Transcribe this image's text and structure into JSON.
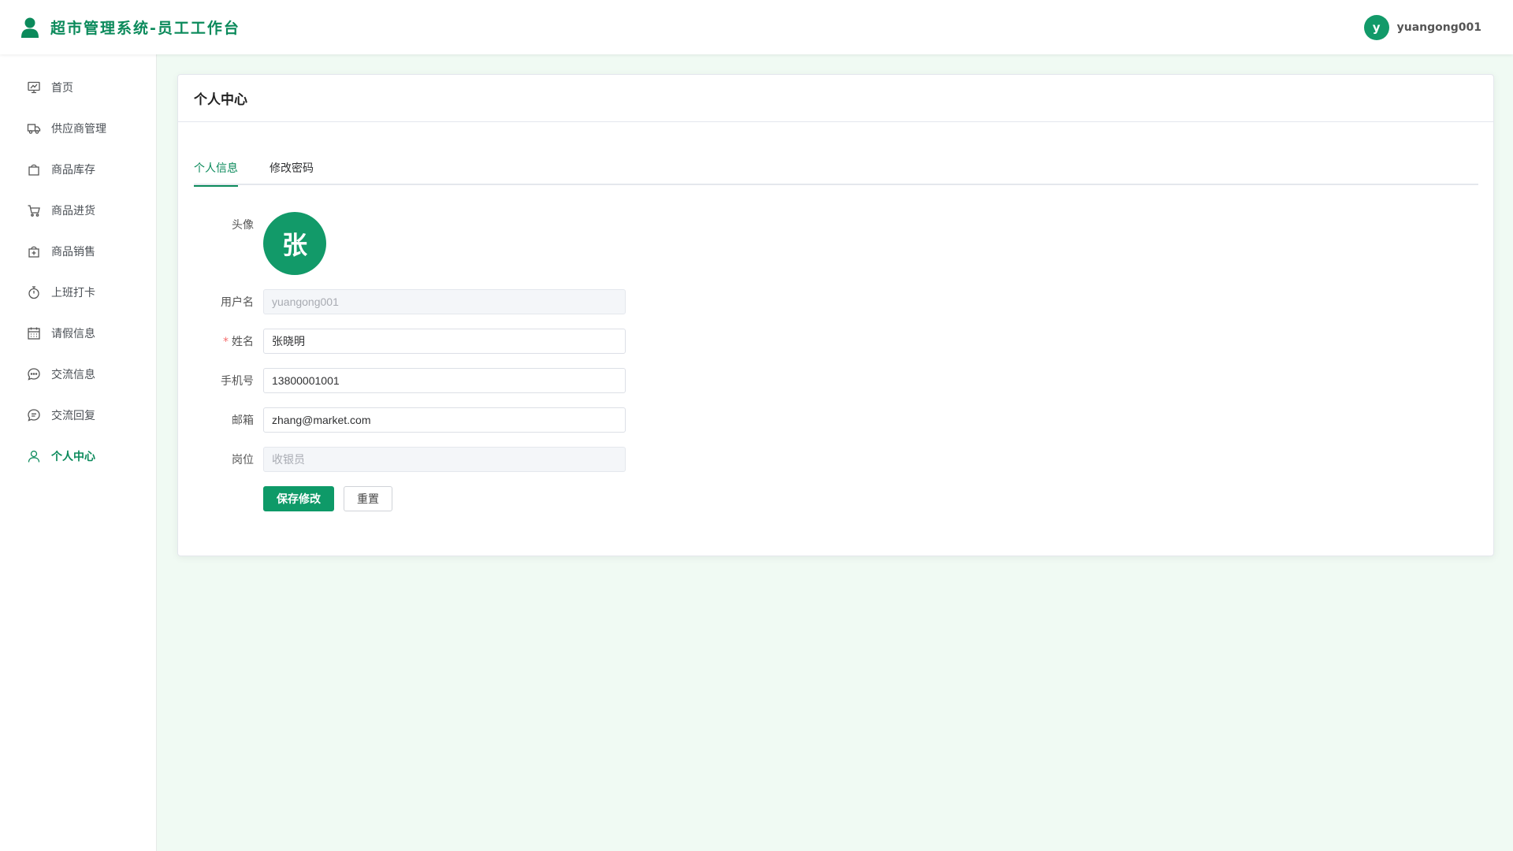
{
  "header": {
    "title": "超市管理系统-员工工作台",
    "user_initial": "y",
    "username": "yuangong001",
    "accent": "#0b8a5b"
  },
  "sidebar": {
    "items": [
      {
        "label": "首页",
        "icon": "dashboard-icon"
      },
      {
        "label": "供应商管理",
        "icon": "truck-icon"
      },
      {
        "label": "商品库存",
        "icon": "shopping-bag-icon"
      },
      {
        "label": "商品进货",
        "icon": "shopping-cart-icon"
      },
      {
        "label": "商品销售",
        "icon": "bag-add-icon"
      },
      {
        "label": "上班打卡",
        "icon": "stopwatch-icon"
      },
      {
        "label": "请假信息",
        "icon": "calendar-icon"
      },
      {
        "label": "交流信息",
        "icon": "chat-dot-icon"
      },
      {
        "label": "交流回复",
        "icon": "chat-line-icon"
      },
      {
        "label": "个人中心",
        "icon": "user-icon",
        "active": true
      }
    ]
  },
  "main": {
    "card_title": "个人中心",
    "tabs": [
      {
        "label": "个人信息",
        "active": true
      },
      {
        "label": "修改密码",
        "active": false
      }
    ],
    "form": {
      "avatar_label": "头像",
      "avatar_char": "张",
      "username_label": "用户名",
      "username_value": "yuangong001",
      "name_label": "姓名",
      "name_required_mark": "*",
      "name_value": "张晓明",
      "phone_label": "手机号",
      "phone_value": "13800001001",
      "email_label": "邮箱",
      "email_value": "zhang@market.com",
      "position_label": "岗位",
      "position_value": "收银员",
      "save_label": "保存修改",
      "reset_label": "重置"
    }
  }
}
